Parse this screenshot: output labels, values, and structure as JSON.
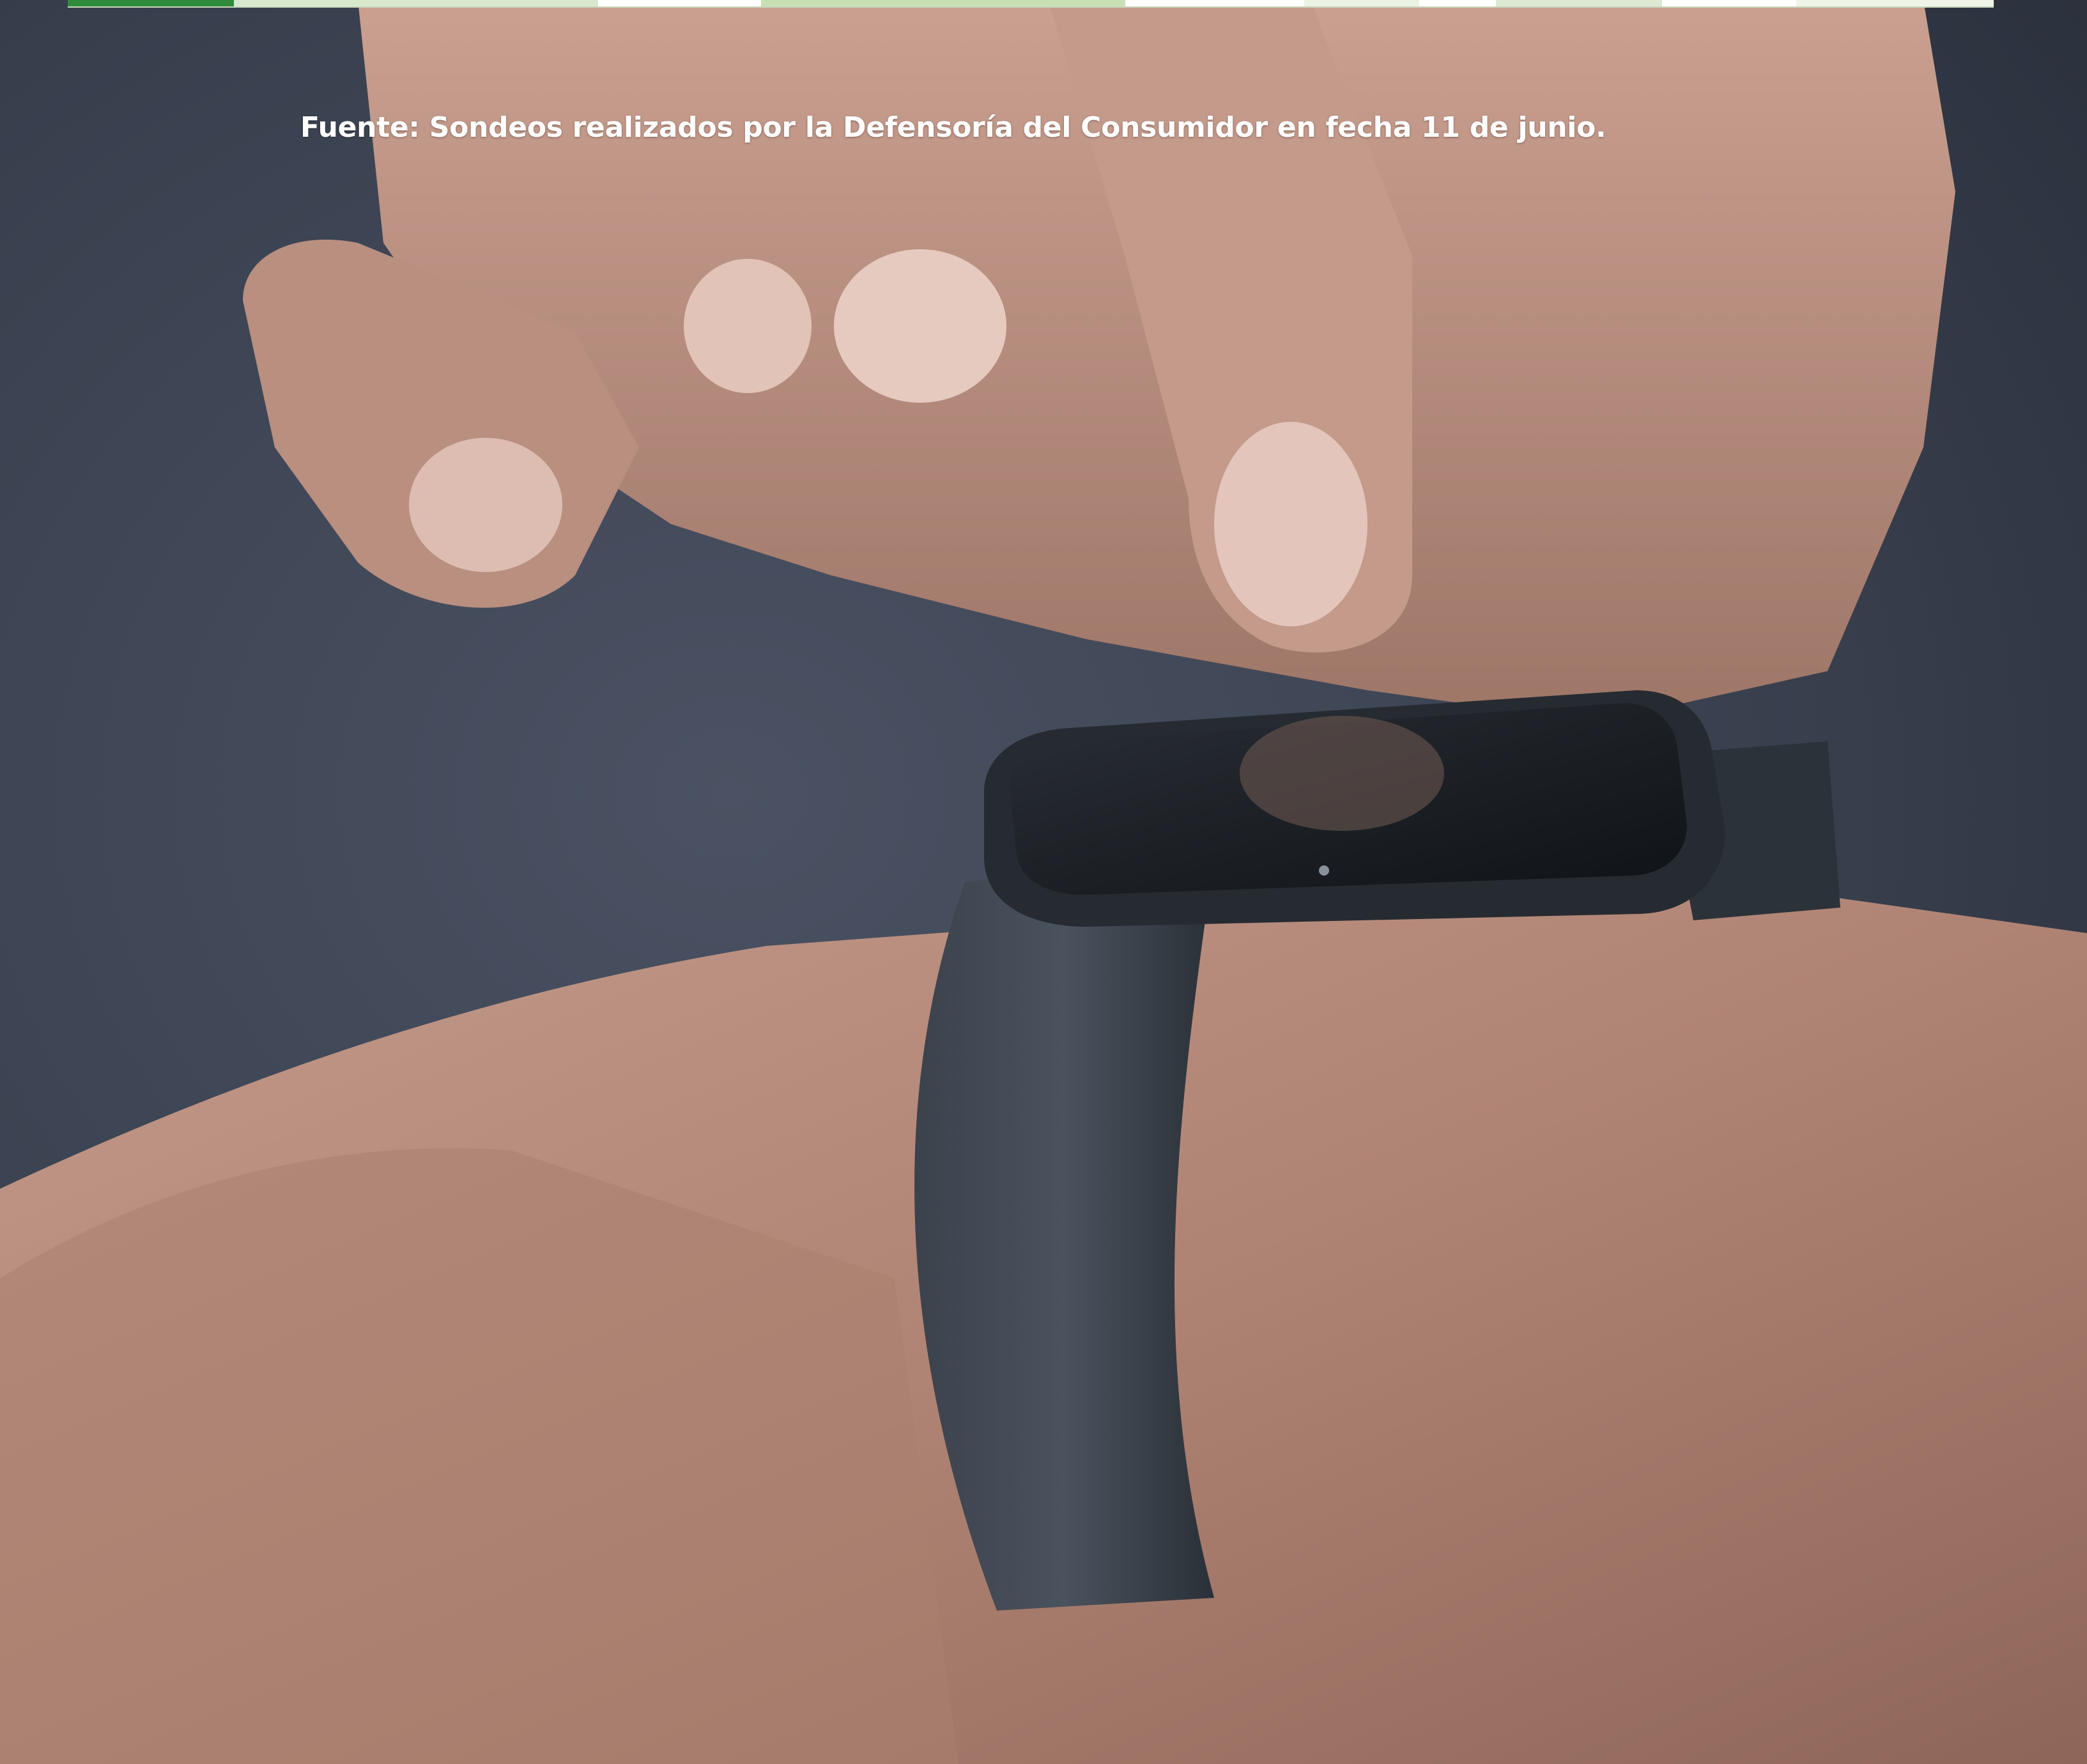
{
  "source_note": "Fuente: Sondeos realizados por la Defensoría del Consumidor en fecha 11 de junio.",
  "table_strip_colors": [
    "#2e8b3a",
    "#d7e8cc",
    "#ffffff",
    "#c6e0b4",
    "#ffffff",
    "#eaf3e3",
    "#ffffff",
    "#dde9d3",
    "#ffffff",
    "#eef5e8"
  ],
  "photo": {
    "subject": "hands tapping smartwatch",
    "background_color": "#3a4150",
    "skin_color": "#b98f80",
    "watch_color": "#2e343c"
  }
}
